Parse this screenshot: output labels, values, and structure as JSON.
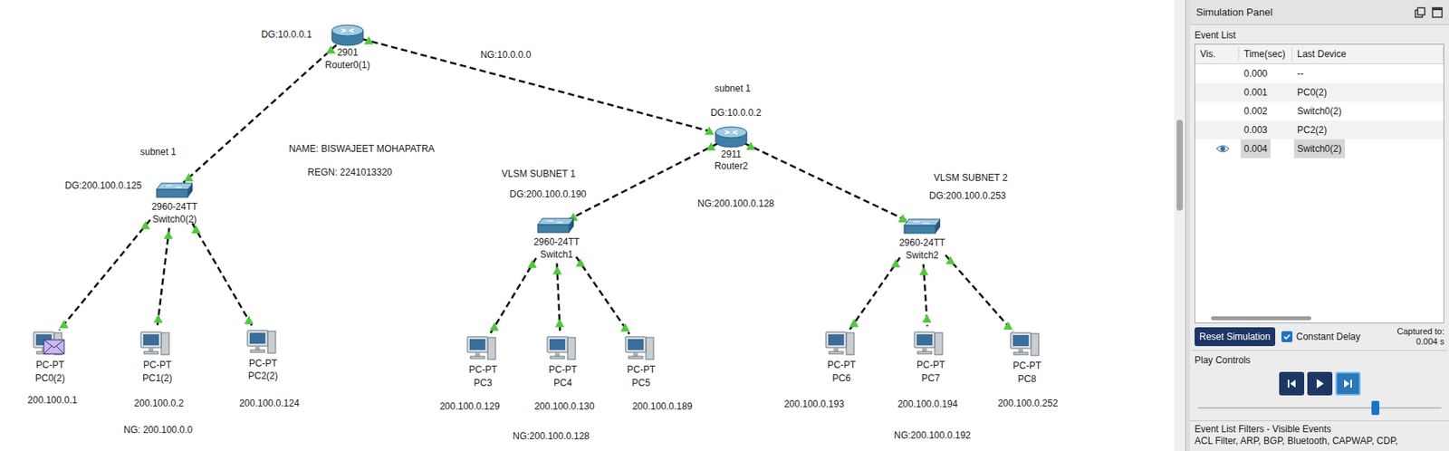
{
  "canvas": {
    "routers": [
      {
        "model": "2901",
        "name": "Router0(1)"
      },
      {
        "model": "2911",
        "name": "Router2"
      }
    ],
    "switches": [
      {
        "model": "2960-24TT",
        "name": "Switch0(2)"
      },
      {
        "model": "2960-24TT",
        "name": "Switch1"
      },
      {
        "model": "2960-24TT",
        "name": "Switch2"
      }
    ],
    "pcs": [
      {
        "type": "PC-PT",
        "name": "PC0(2)",
        "ip": "200.100.0.1",
        "has_pdu": true
      },
      {
        "type": "PC-PT",
        "name": "PC1(2)",
        "ip": "200.100.0.2",
        "has_pdu": false
      },
      {
        "type": "PC-PT",
        "name": "PC2(2)",
        "ip": "200.100.0.124",
        "has_pdu": false
      },
      {
        "type": "PC-PT",
        "name": "PC3",
        "ip": "200.100.0.129",
        "has_pdu": false
      },
      {
        "type": "PC-PT",
        "name": "PC4",
        "ip": "200.100.0.130",
        "has_pdu": false
      },
      {
        "type": "PC-PT",
        "name": "PC5",
        "ip": "200.100.0.189",
        "has_pdu": false
      },
      {
        "type": "PC-PT",
        "name": "PC6",
        "ip": "200.100.0.193",
        "has_pdu": false
      },
      {
        "type": "PC-PT",
        "name": "PC7",
        "ip": "200.100.0.194",
        "has_pdu": false
      },
      {
        "type": "PC-PT",
        "name": "PC8",
        "ip": "200.100.0.252",
        "has_pdu": false
      }
    ],
    "notes": [
      "DG:10.0.0.1",
      "NG:10.0.0.0",
      "subnet 1",
      "DG:200.100.0.125",
      "NAME: BISWAJEET MOHAPATRA",
      "REGN: 2241013320",
      "subnet 1",
      "DG:10.0.0.2",
      "VLSM SUBNET 1",
      "DG:200.100.0.190",
      "NG:200.100.0.128",
      "VLSM SUBNET 2",
      "DG:200.100.0.253",
      "NG: 200.100.0.0",
      "NG:200.100.0.128",
      "NG:200.100.0.192"
    ],
    "links": [
      {
        "from": "Router0(1)",
        "to": "Switch0(2)",
        "up": true
      },
      {
        "from": "Router0(1)",
        "to": "Router2",
        "up": true
      },
      {
        "from": "Router2",
        "to": "Switch1",
        "up": true
      },
      {
        "from": "Router2",
        "to": "Switch2",
        "up": true
      },
      {
        "from": "Switch0(2)",
        "to": "PC0(2)",
        "up": true
      },
      {
        "from": "Switch0(2)",
        "to": "PC1(2)",
        "up": true
      },
      {
        "from": "Switch0(2)",
        "to": "PC2(2)",
        "up": true
      },
      {
        "from": "Switch1",
        "to": "PC3",
        "up": true
      },
      {
        "from": "Switch1",
        "to": "PC4",
        "up": true
      },
      {
        "from": "Switch1",
        "to": "PC5",
        "up": true
      },
      {
        "from": "Switch2",
        "to": "PC6",
        "up": true
      },
      {
        "from": "Switch2",
        "to": "PC7",
        "up": true
      },
      {
        "from": "Switch2",
        "to": "PC8",
        "up": true
      }
    ]
  },
  "simulation_panel": {
    "title": "Simulation Panel",
    "event_list": {
      "label": "Event List",
      "columns": [
        "Vis.",
        "Time(sec)",
        "Last Device"
      ],
      "rows": [
        {
          "vis": false,
          "time": "0.000",
          "last_device": "--",
          "selected": false
        },
        {
          "vis": false,
          "time": "0.001",
          "last_device": "PC0(2)",
          "selected": false
        },
        {
          "vis": false,
          "time": "0.002",
          "last_device": "Switch0(2)",
          "selected": false
        },
        {
          "vis": false,
          "time": "0.003",
          "last_device": "PC2(2)",
          "selected": false
        },
        {
          "vis": true,
          "time": "0.004",
          "last_device": "Switch0(2)",
          "selected": true
        }
      ]
    },
    "reset_button": "Reset Simulation",
    "constant_delay": {
      "label": "Constant Delay",
      "checked": true
    },
    "captured": {
      "label": "Captured to:",
      "value": "0.004 s"
    },
    "play_controls": {
      "label": "Play Controls",
      "buttons": [
        {
          "kind": "back",
          "highlighted": false
        },
        {
          "kind": "play",
          "highlighted": false
        },
        {
          "kind": "forward",
          "highlighted": true
        }
      ],
      "level": 0.73
    },
    "filters": {
      "label": "Event List Filters - Visible Events",
      "value": "ACL Filter, ARP, BGP, Bluetooth, CAPWAP, CDP,"
    }
  }
}
